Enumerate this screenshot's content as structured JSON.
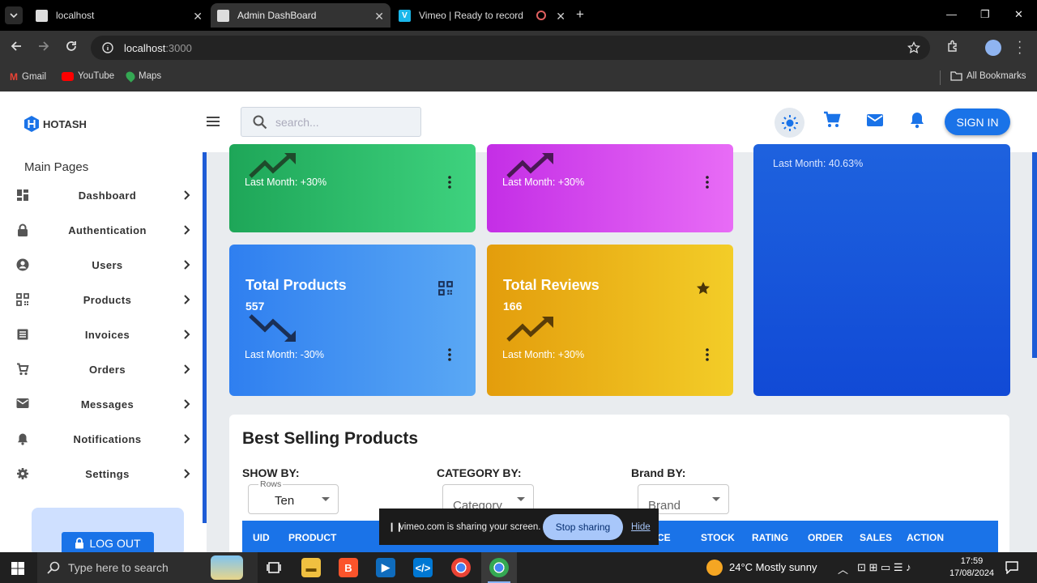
{
  "browser": {
    "tabs": [
      {
        "title": "localhost",
        "active": false
      },
      {
        "title": "Admin DashBoard",
        "active": true
      },
      {
        "title": "Vimeo | Ready to record",
        "active": false
      }
    ],
    "url_host": "localhost",
    "url_port": ":3000",
    "bookmarks": [
      "Gmail",
      "YouTube",
      "Maps"
    ],
    "all_bookmarks": "All Bookmarks"
  },
  "header": {
    "logo_text": "HOTASH",
    "search_placeholder": "search...",
    "sign_in": "SIGN IN"
  },
  "sidebar": {
    "section_title": "Main Pages",
    "items": [
      {
        "label": "Dashboard",
        "icon": "dashboard-icon"
      },
      {
        "label": "Authentication",
        "icon": "lock-icon"
      },
      {
        "label": "Users",
        "icon": "user-icon"
      },
      {
        "label": "Products",
        "icon": "qr-icon"
      },
      {
        "label": "Invoices",
        "icon": "invoice-icon"
      },
      {
        "label": "Orders",
        "icon": "cart-icon"
      },
      {
        "label": "Messages",
        "icon": "mail-icon"
      },
      {
        "label": "Notifications",
        "icon": "bell-icon"
      },
      {
        "label": "Settings",
        "icon": "gear-icon"
      }
    ],
    "logout": "LOG OUT"
  },
  "cards": {
    "top_green": {
      "last": "Last Month: +30%",
      "color": "#2ebd6b"
    },
    "top_purple": {
      "last": "Last Month: +30%",
      "color": "#d63cf0"
    },
    "top_blue": {
      "last": "Last Month: 40.63%",
      "color": "#1656d8"
    },
    "products": {
      "title": "Total Products",
      "value": "557",
      "last": "Last Month: -30%",
      "trend": "down",
      "color": "#3b8ff0"
    },
    "reviews": {
      "title": "Total Reviews",
      "value": "166",
      "last": "Last Month: +30%",
      "trend": "up",
      "color": "#f0b818"
    }
  },
  "best_selling": {
    "title": "Best Selling Products",
    "show_by": "SHOW BY:",
    "category_by": "CATEGORY BY:",
    "brand_by": "Brand BY:",
    "rows_legend": "Rows",
    "rows_value": "Ten",
    "category_placeholder": "Category",
    "brand_placeholder": "Brand",
    "columns": [
      "UID",
      "PRODUCT",
      "CE",
      "STOCK",
      "RATING",
      "ORDER",
      "SALES",
      "ACTION"
    ]
  },
  "share_banner": {
    "message": "vimeo.com is sharing your screen.",
    "stop": "Stop sharing",
    "hide": "Hide"
  },
  "taskbar": {
    "search_placeholder": "Type here to search",
    "weather": "24°C  Mostly sunny",
    "time": "17:59",
    "date": "17/08/2024"
  }
}
